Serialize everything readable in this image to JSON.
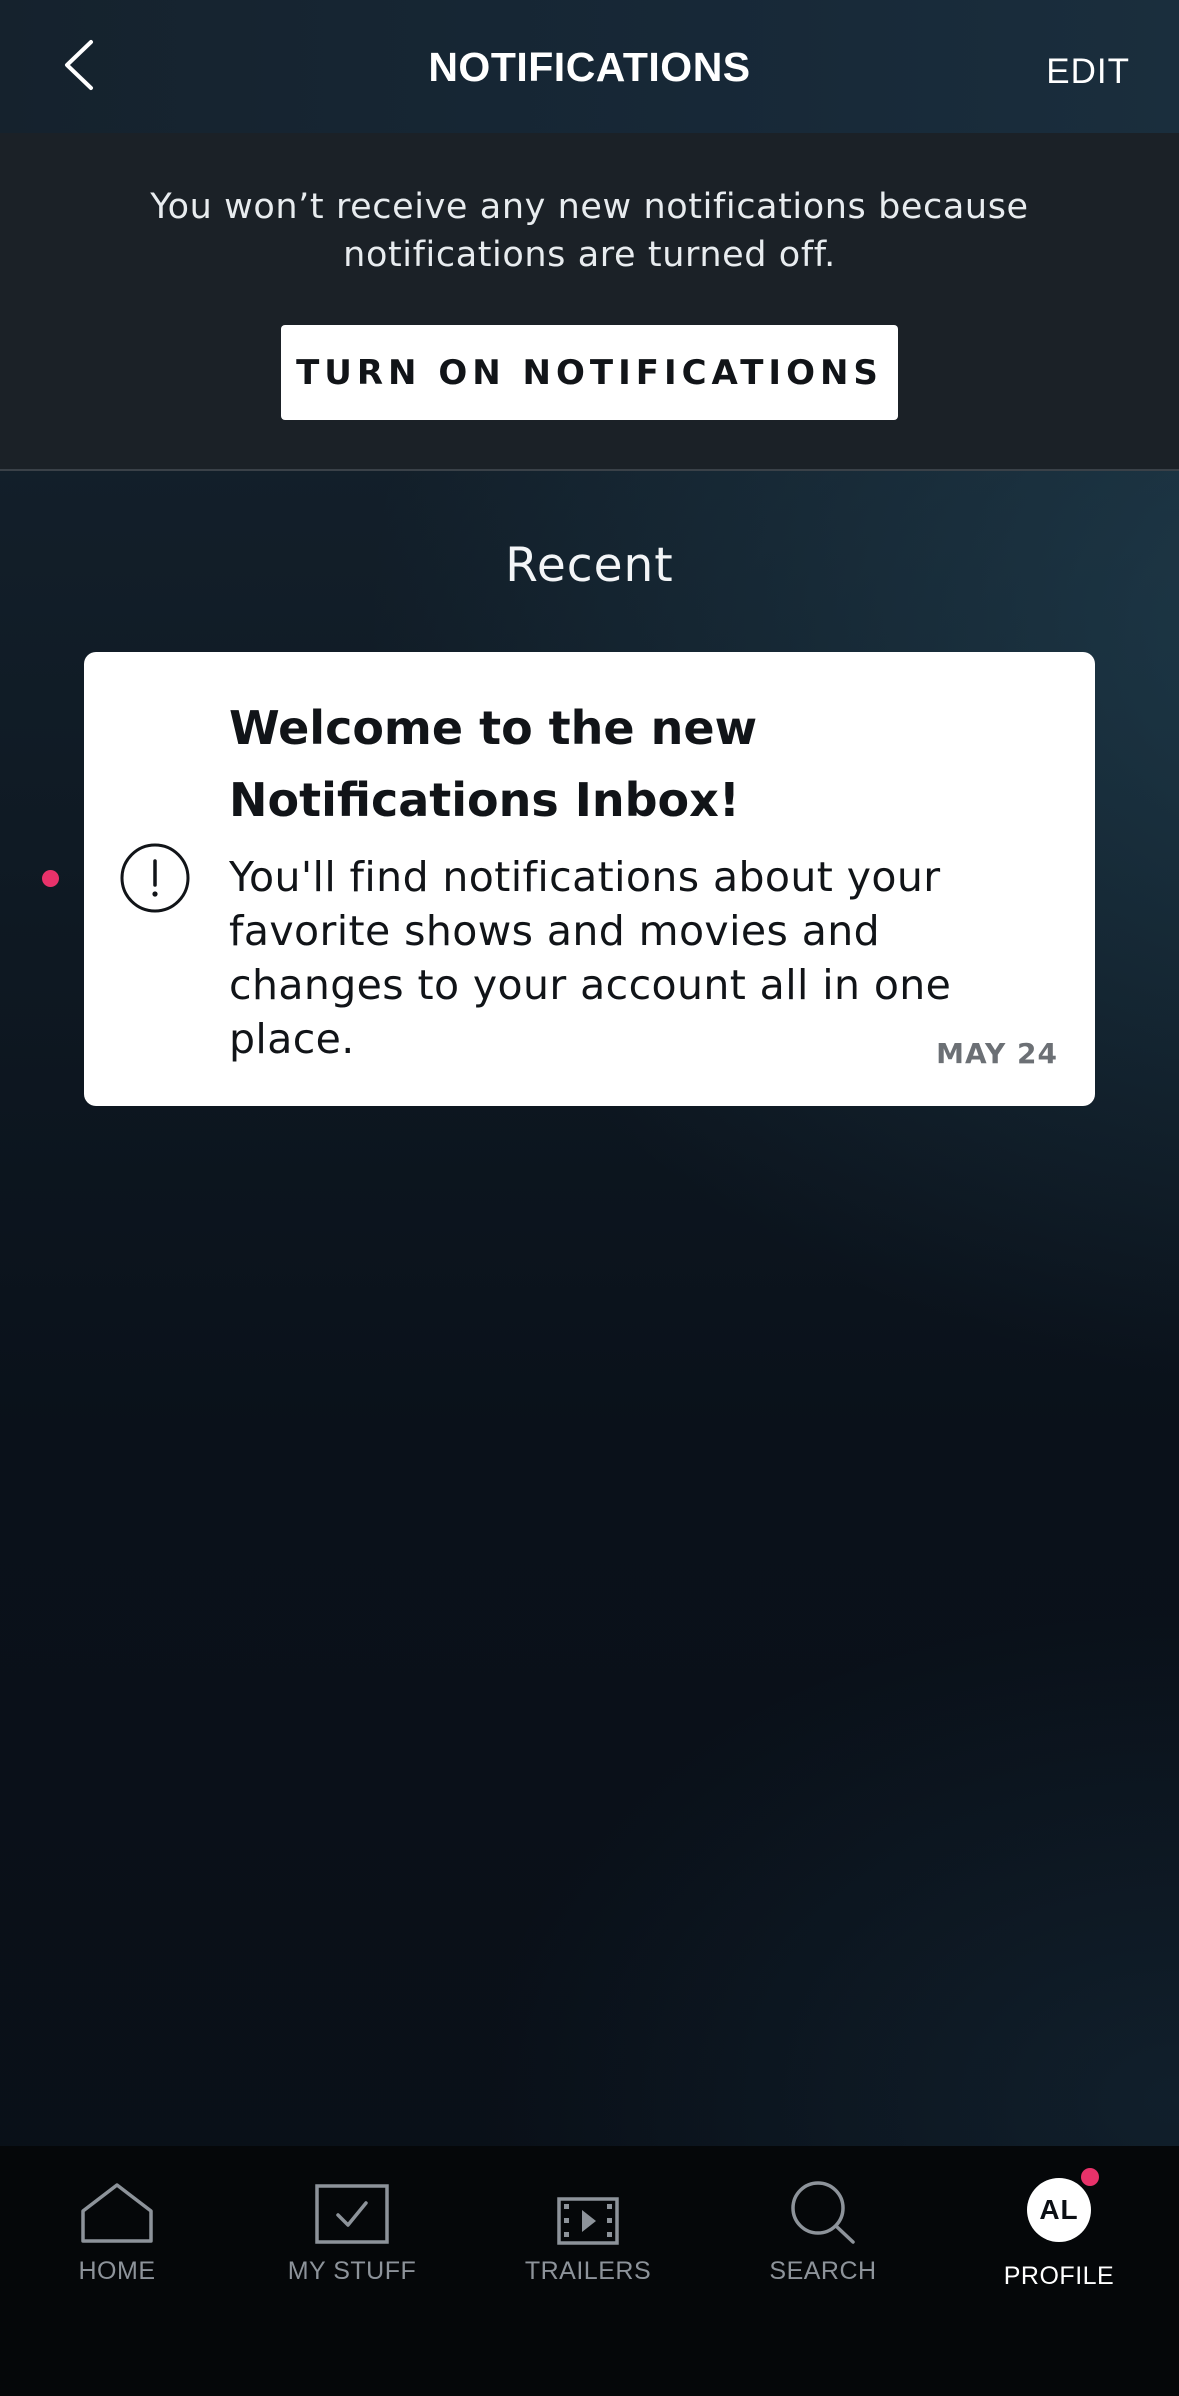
{
  "header": {
    "title": "NOTIFICATIONS",
    "edit_label": "EDIT"
  },
  "banner": {
    "message": "You won’t receive any new notifications because notifications are turned off.",
    "button_label": "TURN ON NOTIFICATIONS"
  },
  "section": {
    "title": "Recent"
  },
  "notification": {
    "title": "Welcome to the new Notifications Inbox!",
    "body": "You'll find notifications about your favorite shows and movies and changes to your account all in one place.",
    "date": "MAY 24",
    "unread": true
  },
  "tabbar": {
    "tabs": [
      {
        "label": "HOME",
        "icon": "home-icon"
      },
      {
        "label": "MY STUFF",
        "icon": "my-stuff-icon"
      },
      {
        "label": "TRAILERS",
        "icon": "film-icon"
      },
      {
        "label": "SEARCH",
        "icon": "search-icon"
      },
      {
        "label": "PROFILE",
        "icon": "avatar",
        "initials": "AL",
        "active": true
      }
    ]
  },
  "colors": {
    "accent_dot": "#e8326a",
    "tab_inactive": "#8d939a",
    "tab_active": "#ffffff"
  }
}
